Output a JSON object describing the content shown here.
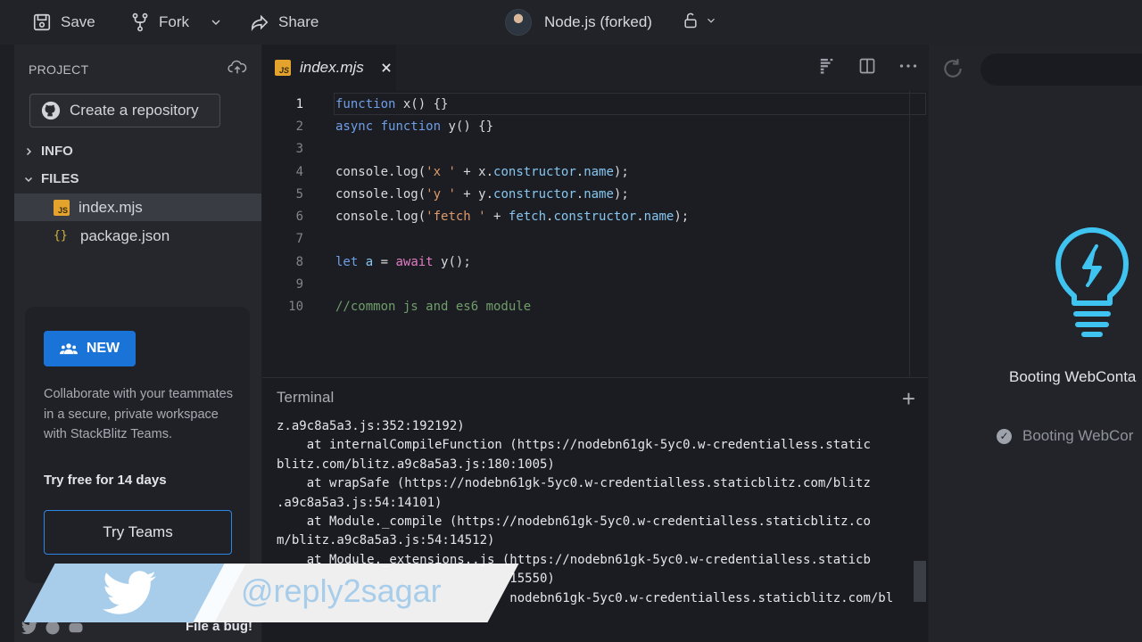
{
  "topbar": {
    "save_label": "Save",
    "fork_label": "Fork",
    "share_label": "Share",
    "project_title": "Node.js (forked)"
  },
  "sidebar": {
    "header": "PROJECT",
    "create_repo_label": "Create a repository",
    "sections": {
      "info": "INFO",
      "files": "FILES"
    },
    "files": [
      {
        "name": "index.mjs",
        "icon": "js-file-icon"
      },
      {
        "name": "package.json",
        "icon": "json-file-icon"
      }
    ],
    "promo": {
      "badge": "NEW",
      "text": "Collaborate with your teammates in a secure, private workspace with StackBlitz Teams.",
      "strong": "Try free for 14 days",
      "button": "Try Teams"
    },
    "bug_label": "File a bug!"
  },
  "editor": {
    "tab_label": "index.mjs",
    "line_numbers": [
      "1",
      "2",
      "3",
      "4",
      "5",
      "6",
      "7",
      "8",
      "9",
      "10"
    ]
  },
  "terminal": {
    "title": "Terminal",
    "lines": [
      "z.a9c8a5a3.js:352:192192)",
      "    at internalCompileFunction (https://nodebn61gk-5yc0.w-credentialless.static",
      "blitz.com/blitz.a9c8a5a3.js:180:1005)",
      "    at wrapSafe (https://nodebn61gk-5yc0.w-credentialless.staticblitz.com/blitz",
      ".a9c8a5a3.js:54:14101)",
      "    at Module._compile (https://nodebn61gk-5yc0.w-credentialless.staticblitz.co",
      "m/blitz.a9c8a5a3.js:54:14512)",
      "    at Module._extensions..js (https://nodebn61gk-5yc0.w-credentialless.staticb",
      "                               15550)",
      "                               nodebn61gk-5yc0.w-credentialless.staticblitz.com/bl"
    ]
  },
  "preview": {
    "booting_title": "Booting WebConta",
    "boot_step": "Booting WebCor"
  },
  "watermark": {
    "handle": "@reply2sagar"
  },
  "colors": {
    "accent_blue": "#1a73d6",
    "bulb_cyan": "#3fc3f0",
    "js_yellow": "#e3a32d"
  }
}
